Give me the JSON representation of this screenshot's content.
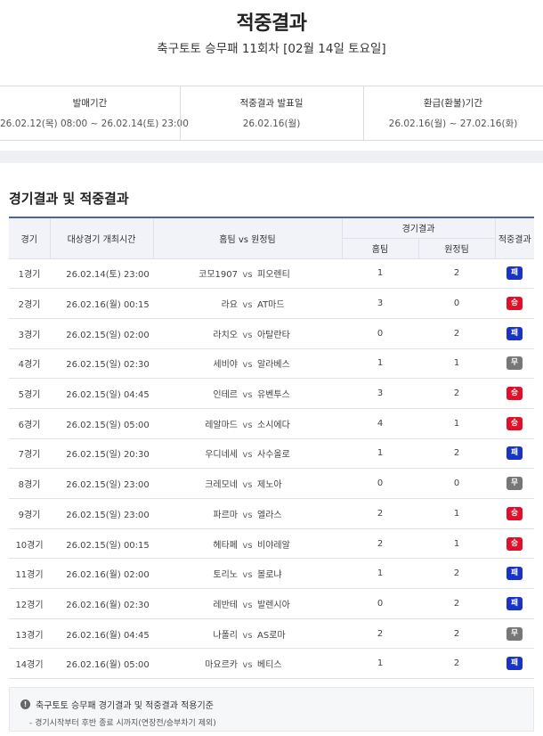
{
  "page": {
    "title": "적중결과",
    "subtitle": "축구토토 승무패 11회차 [02월 14일 토요일]"
  },
  "info": [
    {
      "label": "발매기간",
      "value": "26.02.12(목) 08:00 ~ 26.02.14(토) 23:00"
    },
    {
      "label": "적중결과 발표일",
      "value": "26.02.16(월)"
    },
    {
      "label": "환급(환불)기간",
      "value": "26.02.16(월) ~ 27.02.16(화)"
    }
  ],
  "section_title": "경기결과 및 적중결과",
  "table": {
    "headers": {
      "game": "경기",
      "datetime": "대상경기 개최시간",
      "matchup": "홈팀 vs 원정팀",
      "result": "경기결과",
      "home": "홈팀",
      "away": "원정팀",
      "outcome": "적중결과"
    },
    "vs": "vs",
    "rows": [
      {
        "game": "1경기",
        "datetime": "26.02.14(토) 23:00",
        "home_team": "코모1907",
        "away_team": "피오렌티",
        "home_score": "1",
        "away_score": "2",
        "outcome": "패"
      },
      {
        "game": "2경기",
        "datetime": "26.02.16(월) 00:15",
        "home_team": "라요",
        "away_team": "AT마드",
        "home_score": "3",
        "away_score": "0",
        "outcome": "승"
      },
      {
        "game": "3경기",
        "datetime": "26.02.15(일) 02:00",
        "home_team": "라치오",
        "away_team": "아탈란타",
        "home_score": "0",
        "away_score": "2",
        "outcome": "패"
      },
      {
        "game": "4경기",
        "datetime": "26.02.15(일) 02:30",
        "home_team": "세비야",
        "away_team": "알라베스",
        "home_score": "1",
        "away_score": "1",
        "outcome": "무"
      },
      {
        "game": "5경기",
        "datetime": "26.02.15(일) 04:45",
        "home_team": "인테르",
        "away_team": "유벤투스",
        "home_score": "3",
        "away_score": "2",
        "outcome": "승"
      },
      {
        "game": "6경기",
        "datetime": "26.02.15(일) 05:00",
        "home_team": "레알마드",
        "away_team": "소시에다",
        "home_score": "4",
        "away_score": "1",
        "outcome": "승"
      },
      {
        "game": "7경기",
        "datetime": "26.02.15(일) 20:30",
        "home_team": "우디네세",
        "away_team": "사수올로",
        "home_score": "1",
        "away_score": "2",
        "outcome": "패"
      },
      {
        "game": "8경기",
        "datetime": "26.02.15(일) 23:00",
        "home_team": "크레모네",
        "away_team": "제노아",
        "home_score": "0",
        "away_score": "0",
        "outcome": "무"
      },
      {
        "game": "9경기",
        "datetime": "26.02.15(일) 23:00",
        "home_team": "파르마",
        "away_team": "엘라스",
        "home_score": "2",
        "away_score": "1",
        "outcome": "승"
      },
      {
        "game": "10경기",
        "datetime": "26.02.15(일) 00:15",
        "home_team": "헤타페",
        "away_team": "비야레알",
        "home_score": "2",
        "away_score": "1",
        "outcome": "승"
      },
      {
        "game": "11경기",
        "datetime": "26.02.16(월) 02:00",
        "home_team": "토리노",
        "away_team": "볼로냐",
        "home_score": "1",
        "away_score": "2",
        "outcome": "패"
      },
      {
        "game": "12경기",
        "datetime": "26.02.16(월) 02:30",
        "home_team": "레반테",
        "away_team": "발렌시아",
        "home_score": "0",
        "away_score": "2",
        "outcome": "패"
      },
      {
        "game": "13경기",
        "datetime": "26.02.16(월) 04:45",
        "home_team": "나폴리",
        "away_team": "AS로마",
        "home_score": "2",
        "away_score": "2",
        "outcome": "무"
      },
      {
        "game": "14경기",
        "datetime": "26.02.16(월) 05:00",
        "home_team": "마요르카",
        "away_team": "베티스",
        "home_score": "1",
        "away_score": "2",
        "outcome": "패"
      }
    ]
  },
  "outcome_colors": {
    "승": "#e0102a",
    "패": "#1a33c7",
    "무": "#777777"
  },
  "note": {
    "icon": "info-icon",
    "title": "축구토토 승무패 경기결과 및 적중결과 적용기준",
    "items": [
      "- 경기시작부터 후반 종료 시까지(연장전/승부차기 제외)"
    ]
  }
}
